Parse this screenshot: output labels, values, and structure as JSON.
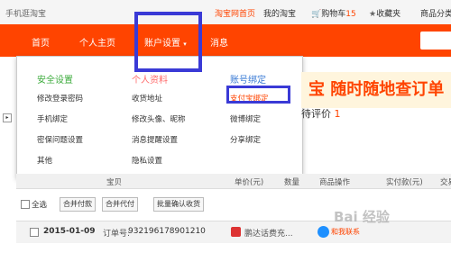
{
  "topbar": {
    "left_text": "手机逛淘宝",
    "home": "淘宝网首页",
    "my_taobao": "我的淘宝",
    "cart": "购物车",
    "cart_count": "15",
    "cart_icon": "cart-icon",
    "favorites": "收藏夹",
    "favorites_icon": "star-icon",
    "categories": "商品分类"
  },
  "nav": {
    "home": "首页",
    "profile": "个人主页",
    "account_settings": "账户设置",
    "account_settings_icon": "chevron-down-icon",
    "messages": "消息"
  },
  "dropdown": {
    "col1": {
      "title": "安全设置",
      "items": [
        "修改登录密码",
        "手机绑定",
        "密保问题设置",
        "其他"
      ]
    },
    "col2": {
      "title": "个人资料",
      "items": [
        "收货地址",
        "修改头像、昵称",
        "消息提醒设置",
        "隐私设置"
      ]
    },
    "col3": {
      "title": "账号绑定",
      "items": [
        "支付宝绑定",
        "微博绑定",
        "分享绑定"
      ]
    }
  },
  "banner": {
    "text": "宝  随时随地查订单"
  },
  "pending": {
    "label": "待评价",
    "count": "1"
  },
  "table": {
    "headers": [
      "宝贝",
      "单价(元)",
      "数量",
      "商品操作",
      "实付款(元)",
      "交易"
    ]
  },
  "actions": {
    "select_all": "全选",
    "merge_pay": "合并付款",
    "merge_pay_for": "合并代付",
    "batch_confirm": "批量确认收货"
  },
  "order": {
    "date": "2015-01-09",
    "order_no_label": "订单号:",
    "order_no": "932196178901210",
    "shop": "鹏达话费充...",
    "chat": "和我联系"
  },
  "watermark": "Bai 经验",
  "colors": {
    "accent": "#ff4400",
    "highlight": "#3a3ad6",
    "green": "#3cab3c",
    "blue": "#3a7bd5"
  }
}
